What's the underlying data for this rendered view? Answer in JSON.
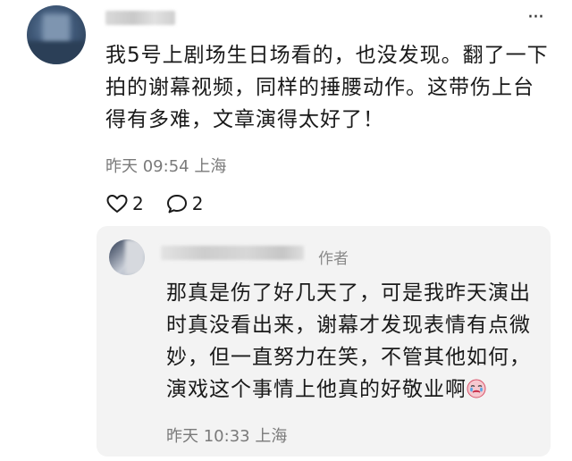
{
  "comment": {
    "text": "我5号上剧场生日场看的，也没发现。翻了一下拍的谢幕视频，同样的捶腰动作。这带伤上台得有多难，文章演得太好了！",
    "time": "昨天 09:54 上海",
    "likes": "2",
    "replies": "2",
    "more_label": "···"
  },
  "reply": {
    "author_tag": "作者",
    "text": "那真是伤了好几天了，可是我昨天演出时真没看出来，谢幕才发现表情有点微妙，但一直努力在笑，不管其他如何，演戏这个事情上他真的好敬业啊",
    "emoji": "crying-face-emoji",
    "time": "昨天 10:33 上海"
  }
}
